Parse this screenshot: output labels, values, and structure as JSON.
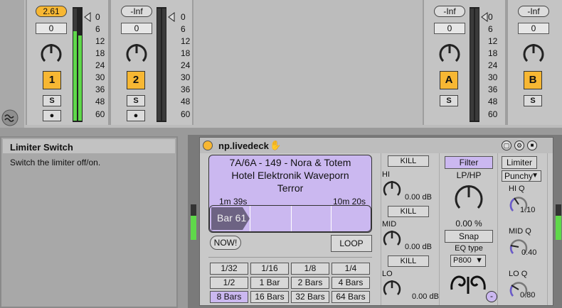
{
  "mixer": {
    "strips": [
      {
        "volume": "2.61",
        "pan": "0",
        "track": "1",
        "solo": "S",
        "arm": "●"
      },
      {
        "volume": "-Inf",
        "pan": "0",
        "track": "2",
        "solo": "S",
        "arm": "●"
      },
      {
        "volume": "-Inf",
        "pan": "0",
        "track": "A",
        "solo": "S"
      },
      {
        "volume": "-Inf",
        "pan": "0",
        "track": "B",
        "solo": "S"
      }
    ],
    "meter_scale": [
      "0",
      "6",
      "12",
      "18",
      "24",
      "30",
      "36",
      "48",
      "60"
    ],
    "strip1_meter_level": 0.8
  },
  "info": {
    "title": "Limiter Switch",
    "body": "Switch the limiter off/on."
  },
  "device": {
    "title": "np.livedeck",
    "track_info": {
      "line1": "7A/6A - 149 - Nora & Totem",
      "line2": "Hotel Elektronik Waveporn",
      "line3": "Terror"
    },
    "elapsed": "1m 39s",
    "remaining": "10m 20s",
    "bar": "Bar 61",
    "now_label": "NOW!",
    "loop_label": "LOOP",
    "loop_sizes": [
      "1/32",
      "1/16",
      "1/8",
      "1/4",
      "1/2",
      "1 Bar",
      "2 Bars",
      "4 Bars",
      "8 Bars",
      "16 Bars",
      "32 Bars",
      "64 Bars"
    ],
    "selected_loop": "8 Bars",
    "eq": {
      "kill": "KILL",
      "hi": "HI",
      "mid": "MID",
      "lo": "LO",
      "hi_db": "0.00 dB",
      "mid_db": "0.00 dB",
      "lo_db": "0.00 dB"
    },
    "filter": {
      "label": "Filter",
      "mode": "LP/HP",
      "value": "0.00 %",
      "snap": "Snap",
      "eq_type_label": "EQ type",
      "eq_type": "P800"
    },
    "limiter": {
      "label": "Limiter",
      "mode": "Punchy",
      "hi_q_label": "HI Q",
      "hi_q": "1.10",
      "mid_q_label": "MID Q",
      "mid_q": "0.40",
      "lo_q_label": "LO Q",
      "lo_q": "0.80",
      "minus": "-"
    }
  }
}
